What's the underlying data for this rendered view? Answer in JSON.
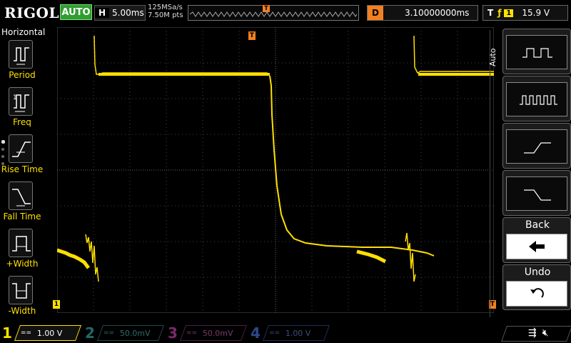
{
  "header": {
    "brand": "RIGOL",
    "mode": "AUTO",
    "timebase_tag": "H",
    "timebase": "5.00ms",
    "sample_rate": "125MSa/s",
    "points": "7.50M pts",
    "delay_tag": "D",
    "delay": "3.10000000ms",
    "trigger_tag": "T",
    "trigger_channel": "1",
    "trigger_level": "15.9 V"
  },
  "left_panel": {
    "title": "Horizontal",
    "items": [
      {
        "label": "Period",
        "icon": "period-icon"
      },
      {
        "label": "Freq",
        "icon": "freq-icon"
      },
      {
        "label": "Rise Time",
        "icon": "rise-time-icon"
      },
      {
        "label": "Fall Time",
        "icon": "fall-time-icon"
      },
      {
        "label": "+Width",
        "icon": "pos-width-icon"
      },
      {
        "label": "-Width",
        "icon": "neg-width-icon"
      }
    ]
  },
  "right_menu": {
    "title": "Auto",
    "buttons": [
      {
        "icon": "single-period-icon"
      },
      {
        "icon": "multi-period-icon"
      },
      {
        "icon": "rising-edge-icon"
      },
      {
        "icon": "falling-edge-icon"
      },
      {
        "label": "Back",
        "icon": "left-arrow-icon"
      },
      {
        "label": "Undo",
        "icon": "undo-icon"
      }
    ]
  },
  "markers": {
    "trigger": "T",
    "ch1": "1"
  },
  "channels": [
    {
      "num": "1",
      "coupling": "==",
      "scale": "1.00 V",
      "color": "#ffe000"
    },
    {
      "num": "2",
      "coupling": "==",
      "scale": "50.0mV",
      "color": "#1f6a6a"
    },
    {
      "num": "3",
      "coupling": "==",
      "scale": "50.0mV",
      "color": "#7a2a6a"
    },
    {
      "num": "4",
      "coupling": "==",
      "scale": "1.00 V",
      "color": "#2a4a8a"
    }
  ],
  "colors": {
    "trace": "#ffe000",
    "trigger": "#f08020",
    "auto_green": "#2f9e2f"
  }
}
